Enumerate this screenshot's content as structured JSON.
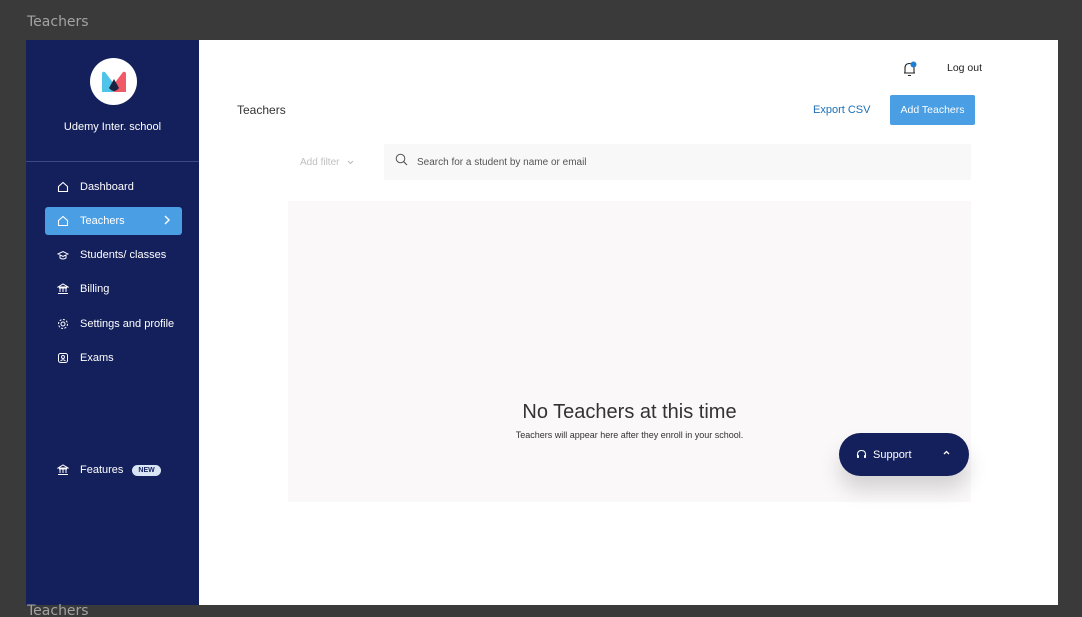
{
  "frame": {
    "label_top": "Teachers",
    "label_bottom": "Teachers"
  },
  "sidebar": {
    "school_name": "Udemy Inter. school",
    "items": [
      {
        "label": "Dashboard",
        "icon": "home-icon"
      },
      {
        "label": "Teachers",
        "icon": "home-icon",
        "active": true
      },
      {
        "label": "Students/ classes",
        "icon": "graduation-cap-icon"
      },
      {
        "label": "Billing",
        "icon": "bank-icon"
      },
      {
        "label": "Settings and profile",
        "icon": "gear-icon"
      },
      {
        "label": "Exams",
        "icon": "exam-icon"
      }
    ],
    "features": {
      "label": "Features",
      "icon": "bank-icon",
      "badge": "NEW"
    }
  },
  "header": {
    "logout": "Log out",
    "page_title": "Teachers",
    "export_csv": "Export CSV",
    "add_teachers": "Add Teachers"
  },
  "filters": {
    "add_filter": "Add filter",
    "search_placeholder": "Search for a student by name or email"
  },
  "empty_state": {
    "title": "No Teachers at this time",
    "subtitle": "Teachers will appear here after they enroll in your school."
  },
  "support": {
    "label": "Support"
  },
  "colors": {
    "sidebar": "#14205c",
    "accent": "#4a9ee4",
    "link": "#1d6fb5"
  }
}
